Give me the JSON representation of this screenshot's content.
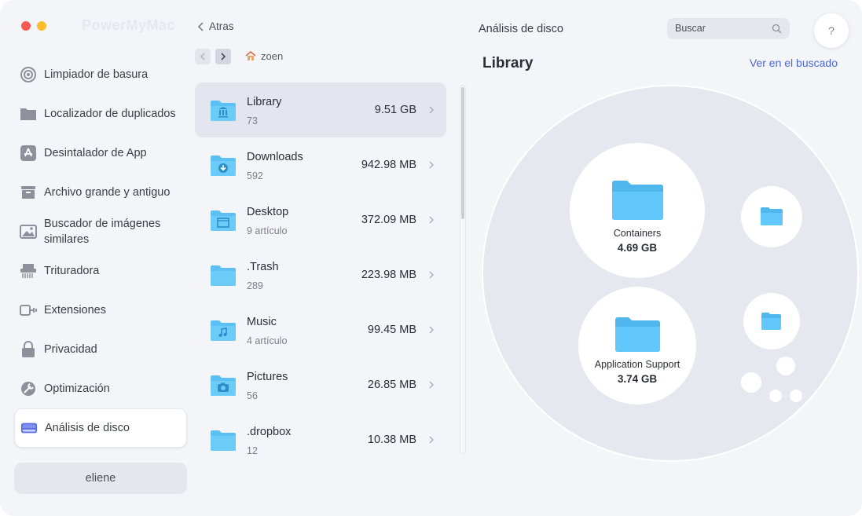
{
  "app": {
    "brand": "PowerMyMac"
  },
  "sidebar": {
    "items": [
      {
        "label": "Limpiador de basura",
        "icon": "broom-target-icon"
      },
      {
        "label": "Localizador de duplicados",
        "icon": "folder-duplicate-icon"
      },
      {
        "label": "Desintalador de App",
        "icon": "app-store-icon"
      },
      {
        "label": "Archivo grande y antiguo",
        "icon": "archive-box-icon"
      },
      {
        "label": "Buscador de imágenes similares",
        "icon": "image-icon"
      },
      {
        "label": "Trituradora",
        "icon": "shredder-icon"
      },
      {
        "label": "Extensiones",
        "icon": "plug-icon"
      },
      {
        "label": "Privacidad",
        "icon": "lock-icon"
      },
      {
        "label": "Optimización",
        "icon": "wrench-icon"
      },
      {
        "label": "Análisis de disco",
        "icon": "disk-icon",
        "active": true
      }
    ],
    "user": "eliene"
  },
  "middle": {
    "back_label": "Atras",
    "breadcrumb": "zoen",
    "files": [
      {
        "name": "Library",
        "count": "73",
        "size": "9.51 GB",
        "icon": "library-folder-icon",
        "active": true
      },
      {
        "name": "Downloads",
        "count": "592",
        "size": "942.98 MB",
        "icon": "downloads-folder-icon"
      },
      {
        "name": "Desktop",
        "count": "9 artículo",
        "size": "372.09 MB",
        "icon": "desktop-folder-icon"
      },
      {
        "name": ".Trash",
        "count": "289",
        "size": "223.98 MB",
        "icon": "folder-icon"
      },
      {
        "name": "Music",
        "count": "4 artículo",
        "size": "99.45 MB",
        "icon": "music-folder-icon"
      },
      {
        "name": "Pictures",
        "count": "56",
        "size": "26.85 MB",
        "icon": "pictures-folder-icon"
      },
      {
        "name": ".dropbox",
        "count": "12",
        "size": "10.38 MB",
        "icon": "folder-icon"
      }
    ]
  },
  "right": {
    "header_title": "Análisis de disco",
    "search_placeholder": "Buscar",
    "help_label": "?",
    "panel_title": "Library",
    "view_link": "Ver en el buscado",
    "bubbles": [
      {
        "name": "Containers",
        "size": "4.69 GB"
      },
      {
        "name": "Application Support",
        "size": "3.74 GB"
      }
    ]
  },
  "colors": {
    "accent_link": "#4a68d8",
    "folder_blue": "#5cc0f5",
    "red": "#fb5a52",
    "yellow": "#fcbc2e"
  }
}
